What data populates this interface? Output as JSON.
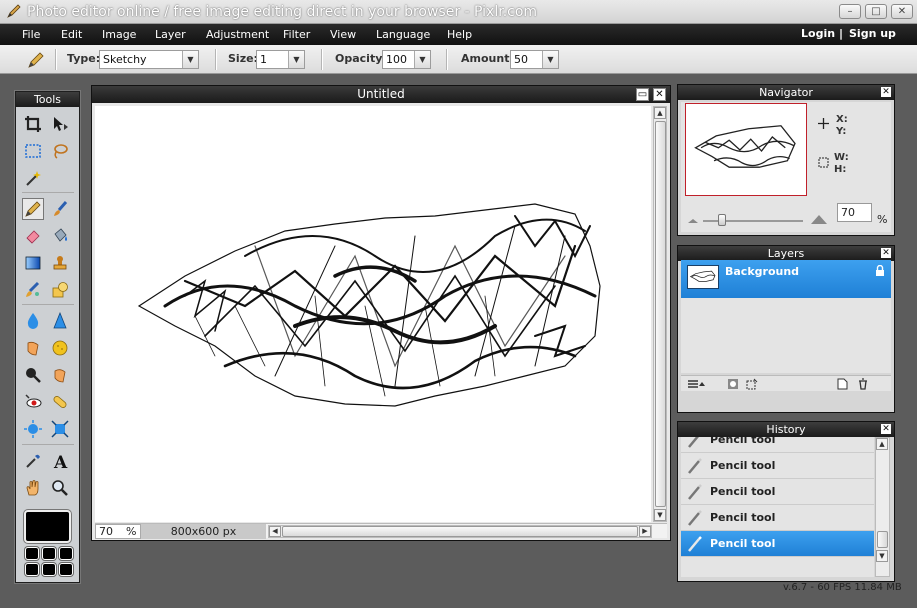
{
  "window": {
    "title": "Photo editor online / free image editing direct in your browser - Pixlr.com",
    "buttons": {
      "minimize": "–",
      "maximize": "□",
      "close": "✕"
    }
  },
  "menu": {
    "items": [
      "File",
      "Edit",
      "Image",
      "Layer",
      "Adjustment",
      "Filter",
      "View",
      "Language",
      "Help"
    ],
    "login": "Login",
    "divider": "|",
    "signup": "Sign up"
  },
  "options": {
    "type_label": "Type:",
    "type_value": "Sketchy",
    "size_label": "Size:",
    "size_value": "1",
    "opacity_label": "Opacity:",
    "opacity_value": "100",
    "amount_label": "Amount:",
    "amount_value": "50"
  },
  "tools": {
    "title": "Tools",
    "icons": [
      "crop-icon",
      "move-icon",
      "marquee-icon",
      "lasso-icon",
      "wand-icon",
      "pencil-icon",
      "brush-icon",
      "eraser-icon",
      "bucket-icon",
      "gradient-icon",
      "stamp-icon",
      "colorreplace-icon",
      "shape-icon",
      "blur-icon",
      "sharpen-icon",
      "smudge-icon",
      "sponge-icon",
      "dodge-icon",
      "burn-icon",
      "redeye-icon",
      "spot-heal-icon",
      "bloat-icon",
      "pinch-icon",
      "eyedropper-icon",
      "text-icon",
      "hand-icon",
      "zoom-icon"
    ],
    "foreground_color": "#000000"
  },
  "document": {
    "title": "Untitled",
    "zoom": "70",
    "zoom_unit": "%",
    "size": "800x600 px"
  },
  "navigator": {
    "title": "Navigator",
    "x_label": "X:",
    "y_label": "Y:",
    "w_label": "W:",
    "h_label": "H:",
    "zoom": "70",
    "zoom_unit": "%"
  },
  "layers": {
    "title": "Layers",
    "items": [
      {
        "name": "Background",
        "locked": true
      }
    ]
  },
  "history": {
    "title": "History",
    "items": [
      "Pencil tool",
      "Pencil tool",
      "Pencil tool",
      "Pencil tool",
      "Pencil tool"
    ],
    "active_index": 4
  },
  "status": {
    "version": "v.6.7 - 60 FPS 11.84 MB"
  },
  "colors": {
    "accent": "#2f8fe0",
    "panel_head": "#2a2a2a",
    "nav_frame": "#c0202a"
  }
}
